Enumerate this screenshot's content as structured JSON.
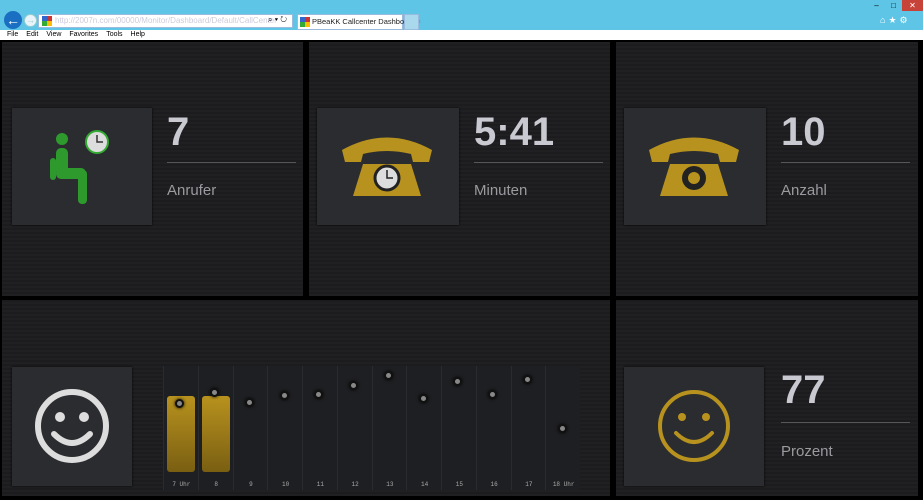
{
  "browser": {
    "address": "http://2007n.com/00000/Monitor/Dashboard/Default/CallCenter",
    "tab_title": "PBeaKK Callcenter Dashboa...",
    "tab_close": "×",
    "menu": [
      "File",
      "Edit",
      "View",
      "Favorites",
      "Tools",
      "Help"
    ],
    "window_controls": [
      "–",
      "□",
      "✕"
    ],
    "toolbar_icons": [
      "⌂",
      "★",
      "⚙"
    ]
  },
  "tiles": {
    "waiting": {
      "value": "7",
      "label": "Anrufer",
      "icon": "waiting-person-clock-icon"
    },
    "wait_time": {
      "value": "5:41",
      "label": "Minuten",
      "icon": "phone-clock-icon"
    },
    "calls": {
      "value": "10",
      "label": "Anzahl",
      "icon": "phone-icon"
    },
    "satisfaction": {
      "value": "77",
      "label": "Prozent",
      "icon": "smiley-icon"
    }
  },
  "colors": {
    "accent": "#b8921e",
    "green": "#2e9a2e"
  },
  "chart_data": {
    "type": "bar",
    "categories": [
      "7 Uhr",
      "8",
      "9",
      "10",
      "11",
      "12",
      "13",
      "14",
      "15",
      "16",
      "17",
      "18 Uhr"
    ],
    "bars": [
      75,
      75,
      null,
      null,
      null,
      null,
      null,
      null,
      null,
      null,
      null,
      null
    ],
    "dots": [
      66,
      76,
      67,
      74,
      75,
      83,
      93,
      71,
      87,
      75,
      89,
      41
    ],
    "ylim": [
      0,
      100
    ]
  }
}
